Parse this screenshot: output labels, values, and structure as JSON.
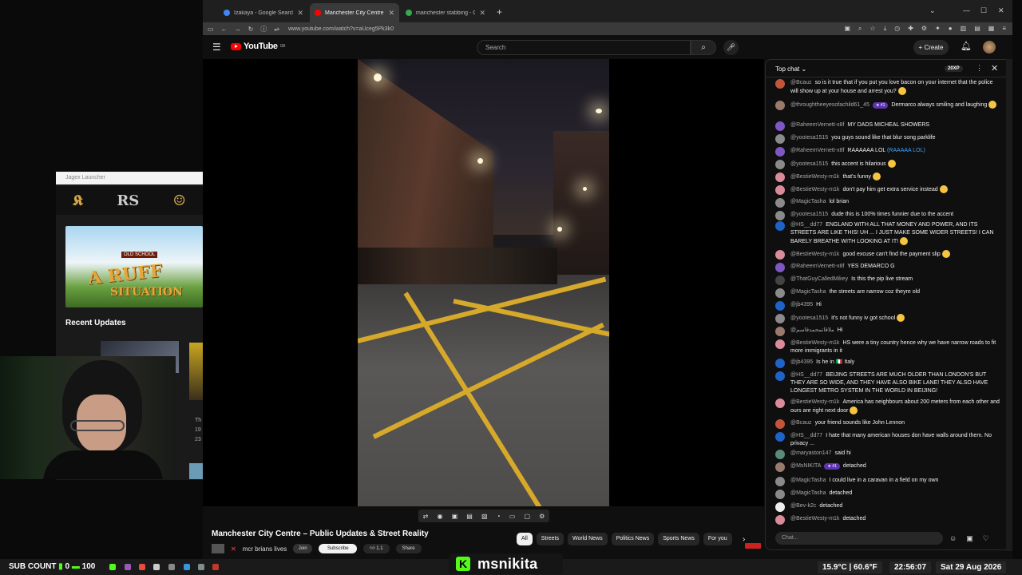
{
  "launcher": {
    "title": "Jagex Launcher",
    "logos": [
      "THE RUNESCAPE COMPANY",
      "RS",
      "OLD SCHOOL"
    ],
    "banner_badge": "OLD SCHOOL",
    "banner_line1": "A RUFF",
    "banner_line2": "SITUATION",
    "recent_updates": "Recent Updates",
    "side_lines": [
      "Th",
      "19",
      "23"
    ]
  },
  "tabs": [
    {
      "label": "Izakaya - Google Search",
      "active": false,
      "color": "#4285f4"
    },
    {
      "label": "Manchester City Centre – P",
      "active": true,
      "color": "#ff0000"
    },
    {
      "label": "manchester stabbing - Google",
      "active": false,
      "color": "#34a853"
    }
  ],
  "address": {
    "url": "www.youtube.com/watch?v=aUceg5Pk3k0"
  },
  "youtube": {
    "logo": "YouTube",
    "region": "GB",
    "search_placeholder": "Search",
    "create_label": "Create"
  },
  "video": {
    "title": "Manchester City Centre – Public Updates & Street Reality",
    "channel": "mcr brians lives",
    "join": "Join",
    "subscribe": "Subscribe",
    "likes": "1.1",
    "share": "Share"
  },
  "chips": [
    "All",
    "Streets",
    "World News",
    "Politics News",
    "Sports News",
    "For you"
  ],
  "chat": {
    "mode": "Top chat",
    "xp": "20XP",
    "input_placeholder": "Chat...",
    "messages": [
      {
        "author": "@Bcauz",
        "text": "so is it true that if you put you love bacon on your internet that the police will show up at your house and arrest you?",
        "emoji": true,
        "color": "#c2543a"
      },
      {
        "author": "@throughtheeyesofachild61_45",
        "badge": "#1",
        "text": "Dermarco always smiling and laughing",
        "emoji": true,
        "color": "#9a7a6a"
      },
      {
        "author": "@RaheemVernett-x8f",
        "text": "MY DADS MICHEAL SHOWERS",
        "color": "#7e57c2"
      },
      {
        "author": "@yootesa1515",
        "text": "you guys sound like that blur song parklife",
        "color": "#8a8a8a"
      },
      {
        "author": "@RaheemVernett-x8f",
        "text": "RAAAAAA LOL",
        "link": "(RAAAAA LOL)",
        "color": "#7e57c2"
      },
      {
        "author": "@yootesa1515",
        "text": "this accent is hilarious",
        "emoji": true,
        "color": "#8a8a8a"
      },
      {
        "author": "@BestieWesty-m1k",
        "text": "that's funny",
        "emoji": true,
        "color": "#d98b9a"
      },
      {
        "author": "@BestieWesty-m1k",
        "text": "don't pay him get extra service instead",
        "emoji": true,
        "color": "#d98b9a"
      },
      {
        "author": "@MagicTasha",
        "text": "lol brian",
        "color": "#8a8a8a"
      },
      {
        "author": "@yootesa1515",
        "text": "dude this is 100% times funnier due to the accent",
        "color": "#8a8a8a"
      },
      {
        "author": "@HS__dd77",
        "text": "ENGLAND WITH ALL THAT MONEY AND POWER, AND ITS STREETS ARE LIKE THIS! UH ... I JUST MAKE SOME WIDER STREETS! I CAN BARELY BREATHE WITH LOOKING AT IT!",
        "emoji": true,
        "color": "#1e64c8"
      },
      {
        "author": "@BestieWesty-m1k",
        "text": "good excuse can't find the payment slip",
        "emoji": true,
        "color": "#d98b9a"
      },
      {
        "author": "@RaheemVernett-x8f",
        "text": "YES DEMARCO G",
        "color": "#7e57c2"
      },
      {
        "author": "@ThatGuyCalledMikey",
        "text": "Is this the pip live stream",
        "color": "#444444"
      },
      {
        "author": "@MagicTasha",
        "text": "the streets are narrow coz theyre old",
        "color": "#8a8a8a"
      },
      {
        "author": "@jb4395",
        "text": "Hi",
        "color": "#1e64c8"
      },
      {
        "author": "@yootesa1515",
        "text": "it's not funny iv got school",
        "emoji": true,
        "color": "#8a8a8a"
      },
      {
        "author": "@ملاقاتمحمدقاسم",
        "text": "Hi",
        "color": "#9a7a6a"
      },
      {
        "author": "@BestieWesty-m1k",
        "text": "HS were a tiny country hence why we have narrow roads to fit more immigrants in it",
        "color": "#d98b9a"
      },
      {
        "author": "@jb4395",
        "text": "Is he in 🇮🇹 Italy",
        "color": "#1e64c8"
      },
      {
        "author": "@HS__dd77",
        "text": "BEIJING STREETS ARE MUCH OLDER THAN LONDON'S BUT THEY ARE SO WIDE, AND THEY HAVE ALSO BIKE LANE! THEY ALSO HAVE LONGEST METRO SYSTEM IN THE WORLD IN BEIJING!",
        "color": "#1e64c8"
      },
      {
        "author": "@BestieWesty-m1k",
        "text": "America has neighbours about 200 meters from each other and ours are right next door",
        "emoji": true,
        "color": "#d98b9a"
      },
      {
        "author": "@Bcauz",
        "text": "your friend sounds like John Lennon",
        "color": "#c2543a"
      },
      {
        "author": "@HS__dd77",
        "text": "I hate that many american houses don have walls around them. No privacy ...",
        "color": "#1e64c8"
      },
      {
        "author": "@maryaston147",
        "text": "said hi",
        "color": "#5a8a7a"
      },
      {
        "author": "@MsNIKITA",
        "badge": "#1",
        "text": "detached",
        "color": "#9a7a6a"
      },
      {
        "author": "@MagicTasha",
        "text": "I could live in a caravan in a field on my own",
        "color": "#8a8a8a"
      },
      {
        "author": "@MagicTasha",
        "text": "detached",
        "color": "#8a8a8a"
      },
      {
        "author": "@Bev-k2c",
        "text": "detached",
        "color": "#eeeeee"
      },
      {
        "author": "@BestieWesty-m1k",
        "text": "detached",
        "color": "#d98b9a"
      }
    ]
  },
  "taskbar": {
    "sub_label": "SUB COUNT",
    "sub_current": "0",
    "sub_goal": "100",
    "brand": "msnikita",
    "weather": "15.9°C | 60.6°F",
    "time": "22:56:07",
    "date": "Sat 29 Aug 2026"
  }
}
